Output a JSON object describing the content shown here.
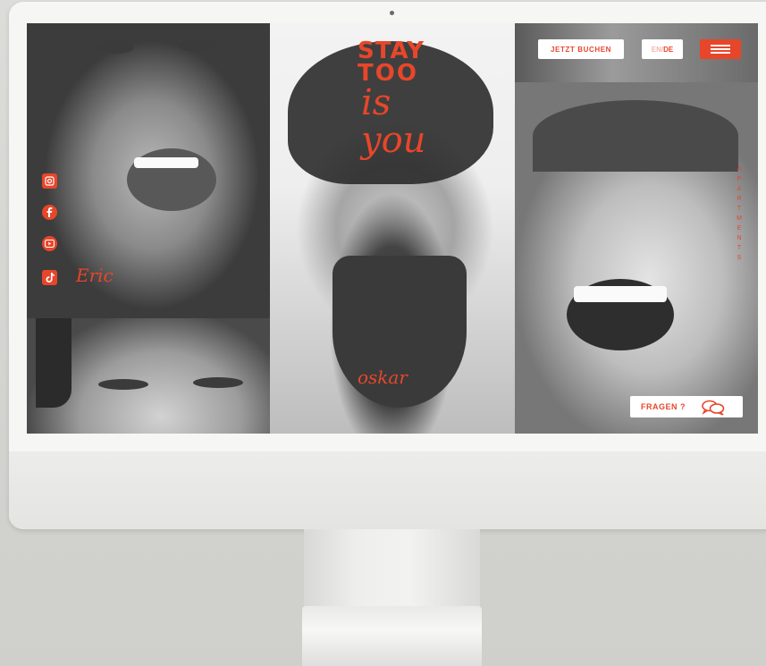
{
  "header": {
    "book_label": "JETZT BUCHEN",
    "lang_en": "EN",
    "lang_sep": "/",
    "lang_de": "DE"
  },
  "logo": {
    "line1": "STAY",
    "line2": "TOO",
    "script": "is you"
  },
  "names": {
    "left": "Eric",
    "center": "oskar"
  },
  "side_nav": {
    "vertical_label": [
      "A",
      "P",
      "A",
      "R",
      "T",
      "M",
      "E",
      "N",
      "T",
      "S"
    ]
  },
  "social": {
    "icons": [
      "instagram-icon",
      "facebook-icon",
      "youtube-icon",
      "tiktok-icon"
    ]
  },
  "help": {
    "fragen_label": "FRAGEN ?"
  },
  "colors": {
    "accent": "#e8462a",
    "white": "#ffffff"
  }
}
